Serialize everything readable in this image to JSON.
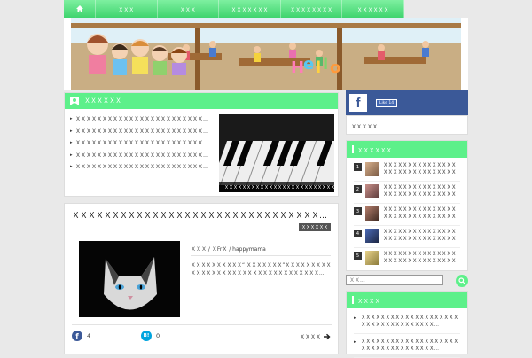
{
  "nav": {
    "home_label": "",
    "items": [
      "ＸＸＸ",
      "ＸＸＸ",
      "ＸＸＸＸＸＸＸ",
      "ＸＸＸＸＸＸＸＸ",
      "ＸＸＸＸＸＸ"
    ]
  },
  "header": {
    "banner_text": "Hello"
  },
  "news": {
    "title": "ＸＸＸＸＸＸ",
    "items": [
      "ＸＸＸＸＸＸＸＸＸＸＸＸＸＸＸＸＸＸＸＸＸＸＸＸＸＸＸＸＸＸＸＸＸＸＸ…",
      "ＸＸＸＸＸＸＸＸＸＸＸＸＸＸＸＸＸＸＸＸＸＸＸＸＸＸＸＸＸＸＸＸＸＸＸ…",
      "ＸＸＸＸＸＸＸＸＸＸＸＸＸＸＸＸＸＸＸＸＸＸＸＸＸＸＸＸＸＸＸＸＸＸＸ…",
      "ＸＸＸＸＸＸＸＸＸＸＸＸＸＸＸＸＸＸＸＸＸＸＸＸＸＸＸＸＸＸＸＸＸＸＸ…",
      "ＸＸＸＸＸＸＸＸＸＸＸＸＸＸＸＸＸＸＸＸＸＸＸＸＸＸＸＸＸＸＸＸＸＸ"
    ],
    "image_caption": "ＸＸＸＸＸＸＸＸＸＸＸＸＸＸＸＸＸＸＸＸＸＸＸＸＸＸＸＸＸＸＸ"
  },
  "article": {
    "title": "ＸＸＸＸＸＸＸＸＸＸＸＸＸＸＸＸＸＸＸＸＸＸＸＸＸＸＸＸＸＸＸ…",
    "category_tag": "ＸＸＸＸＸＸ",
    "meta": "ＸＸＸ / ＸFrＸ / happymama",
    "excerpt": "ＸＸＸＸＸＸＸＸＸＸ“ ＸＸＸＸＸＸＸ”ＸＸＸＸＸＸＸＸＸＸＸＸＸＸＸＸＸＸＸＸＸＸＸＸＸＸＸＸＸＸＸＸＸＸ…",
    "facebook_count": "4",
    "hatena_count": "0",
    "read_more": "ＸＸＸＸ"
  },
  "sidebar": {
    "facebook_like": "Like 14",
    "fb_box_text": "ＸＸＸＸＸ",
    "ranking_title": "ＸＸＸＸＸＸ",
    "ranking": [
      {
        "num": "1",
        "text": "ＸＸＸＸＸＸＸＸＸＸＸＸＸＸＸＸＸＸＸＸＸＸＸＸＸＸＸＸＸＸＸＸＸＸＸ…"
      },
      {
        "num": "2",
        "text": "ＸＸＸＸＸＸＸＸＸＸＸＸＸＸＸＸＸＸＸＸＸＸＸＸＸＸＸＸＸＸＸＸＸＸＸ…"
      },
      {
        "num": "3",
        "text": "ＸＸＸＸＸＸＸＸＸＸＸＸＸＸＸＸＸＸＸＸＸＸＸＸＸＸＸＸＸＸＸＸＸＸＸ…"
      },
      {
        "num": "4",
        "text": "ＸＸＸＸＸＸＸＸＸＸＸＸＸＸＸＸＸＸＸＸＸＸＸＸＸＸＸＸＸＸＸＸＸＸＸ…"
      },
      {
        "num": "5",
        "text": "ＸＸＸＸＸＸＸＸＸＸＸＸＸＸＸＸＸＸＸＸＸＸＸＸＸＸＸＸＸＸＸＸＸＸＸ…"
      }
    ],
    "search_placeholder": "ＸＸ...",
    "popular_title": "ＸＸＸＸ",
    "popular": [
      "ＸＸＸＸＸＸＸＸＸＸＸＸＸＸＸＸＸＸＸＸＸＸＸＸＸＸＸＸＸＸＸＸＸＸＸ…",
      "ＸＸＸＸＸＸＸＸＸＸＸＸＸＸＸＸＸＸＸＸＸＸＸＸＸＸＸＸＸＸＸＸＸＸＸ…"
    ]
  },
  "colors": {
    "accent": "#5df08a",
    "facebook": "#3b5998",
    "hatena": "#00a4de"
  }
}
